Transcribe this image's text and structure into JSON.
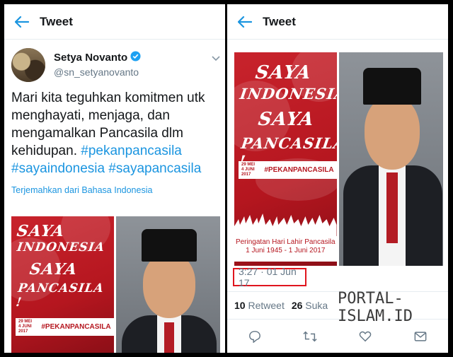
{
  "header": {
    "title": "Tweet"
  },
  "author": {
    "name": "Setya Novanto",
    "handle": "@sn_setyanovanto"
  },
  "tweet": {
    "text_plain": "Mari kita teguhkan komitmen utk menghayati, menjaga, dan mengamalkan Pancasila dlm kehidupan.",
    "hashtags": [
      "#pekanpancasila",
      "#sayaindonesia",
      "#sayapancasila"
    ],
    "translate_link": "Terjemahkan dari Bahasa Indonesia",
    "timestamp": "3:27 · 01 Jun 17"
  },
  "poster": {
    "line1": "SAYA",
    "line2": "INDONESIA",
    "line3": "SAYA",
    "line4": "PANCASILA !",
    "badge_date_1": "29 MEI",
    "badge_date_2": "4 JUNI 2017",
    "hashtag": "#PEKANPANCASILA",
    "caption_line1": "Peringatan Hari Lahir Pancasila",
    "caption_line2": "1 Juni 1945 - 1 Juni 2017"
  },
  "stats": {
    "retweets": "10",
    "retweet_label": "Retweet",
    "likes": "26",
    "like_label": "Suka"
  },
  "watermark": "PORTAL-ISLAM.ID",
  "colors": {
    "accent": "#1b95e0",
    "poster_red": "#c8232c",
    "highlight_red": "#e0151e"
  },
  "icons": [
    "back-arrow-icon",
    "verified-badge-icon",
    "chevron-down-icon",
    "reply-icon",
    "retweet-icon",
    "like-icon",
    "message-icon"
  ]
}
